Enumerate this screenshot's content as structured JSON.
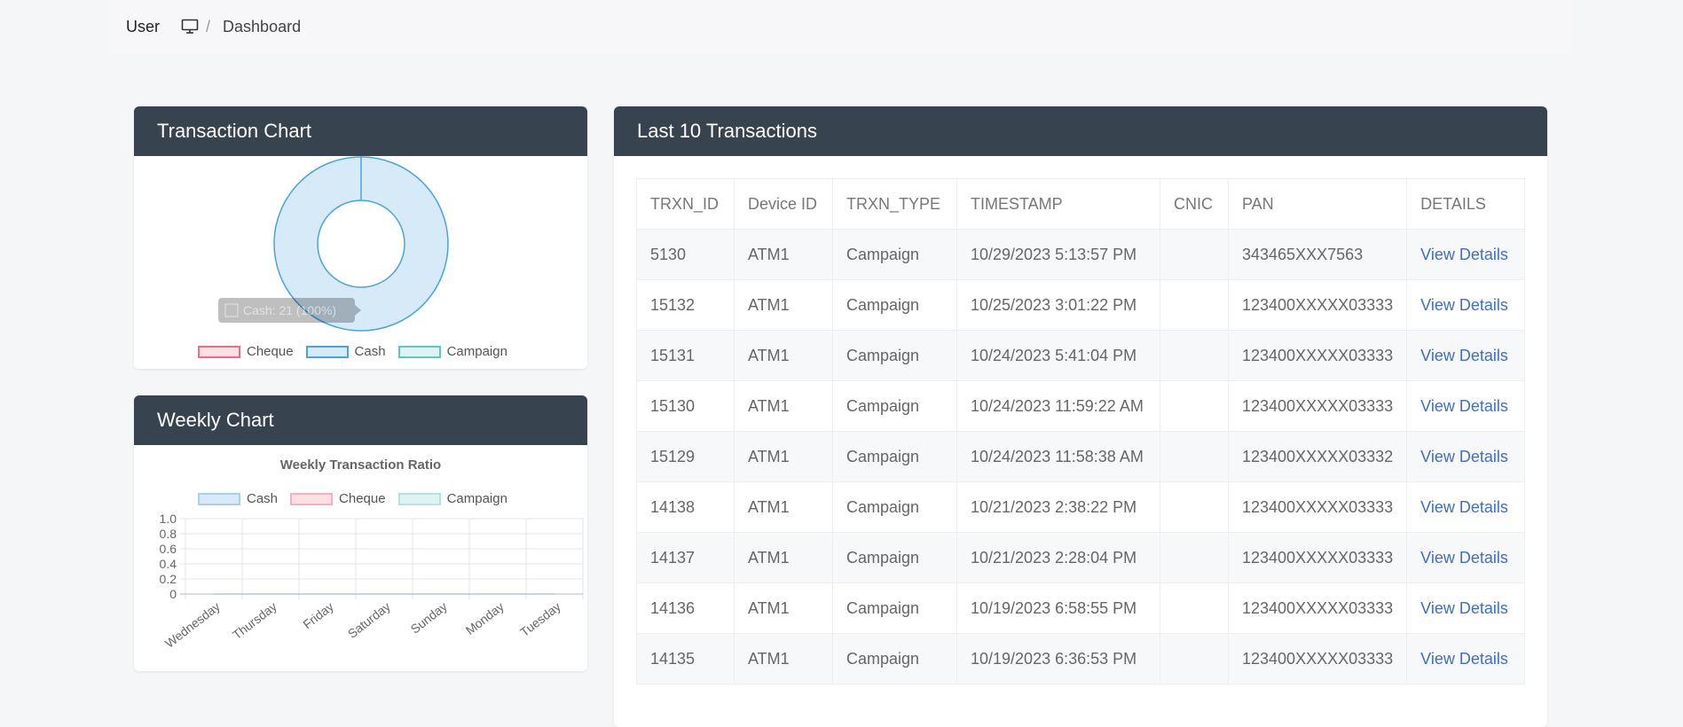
{
  "topbar": {
    "user_label": "User",
    "breadcrumb_icon": "monitor-icon",
    "breadcrumb_separator": "/",
    "breadcrumb_current": "Dashboard"
  },
  "transaction_chart": {
    "title": "Transaction Chart",
    "tooltip": "Cash: 21 (100%)",
    "legend": [
      "Cheque",
      "Cash",
      "Campaign"
    ]
  },
  "weekly_chart": {
    "title": "Weekly Chart"
  },
  "last10": {
    "title": "Last 10 Transactions",
    "columns": [
      "TRXN_ID",
      "Device ID",
      "TRXN_TYPE",
      "TIMESTAMP",
      "CNIC",
      "PAN",
      "DETAILS"
    ],
    "rows": [
      {
        "id": "5130",
        "device": "ATM1",
        "type": "Campaign",
        "ts": "10/29/2023 5:13:57 PM",
        "cnic": "",
        "pan": "343465XXX7563",
        "details": "View Details"
      },
      {
        "id": "15132",
        "device": "ATM1",
        "type": "Campaign",
        "ts": "10/25/2023 3:01:22 PM",
        "cnic": "",
        "pan": "123400XXXXX03333",
        "details": "View Details"
      },
      {
        "id": "15131",
        "device": "ATM1",
        "type": "Campaign",
        "ts": "10/24/2023 5:41:04 PM",
        "cnic": "",
        "pan": "123400XXXXX03333",
        "details": "View Details"
      },
      {
        "id": "15130",
        "device": "ATM1",
        "type": "Campaign",
        "ts": "10/24/2023 11:59:22 AM",
        "cnic": "",
        "pan": "123400XXXXX03333",
        "details": "View Details"
      },
      {
        "id": "15129",
        "device": "ATM1",
        "type": "Campaign",
        "ts": "10/24/2023 11:58:38 AM",
        "cnic": "",
        "pan": "123400XXXXX03332",
        "details": "View Details"
      },
      {
        "id": "14138",
        "device": "ATM1",
        "type": "Campaign",
        "ts": "10/21/2023 2:38:22 PM",
        "cnic": "",
        "pan": "123400XXXXX03333",
        "details": "View Details"
      },
      {
        "id": "14137",
        "device": "ATM1",
        "type": "Campaign",
        "ts": "10/21/2023 2:28:04 PM",
        "cnic": "",
        "pan": "123400XXXXX03333",
        "details": "View Details"
      },
      {
        "id": "14136",
        "device": "ATM1",
        "type": "Campaign",
        "ts": "10/19/2023 6:58:55 PM",
        "cnic": "",
        "pan": "123400XXXXX03333",
        "details": "View Details"
      },
      {
        "id": "14135",
        "device": "ATM1",
        "type": "Campaign",
        "ts": "10/19/2023 6:36:53 PM",
        "cnic": "",
        "pan": "123400XXXXX03333",
        "details": "View Details"
      }
    ]
  },
  "colors": {
    "header_bg": "#37444f",
    "link": "#3f6ec6",
    "cash_fill": "#d6eaf8",
    "cash_border": "#4aa3df",
    "cheque_fill": "#fde0e6",
    "cheque_border": "#f06b86",
    "campaign_fill": "#dff3f2",
    "campaign_border": "#5cc8c0"
  },
  "chart_data": [
    {
      "type": "pie",
      "categories": [
        "Cheque",
        "Cash",
        "Campaign"
      ],
      "values": [
        0,
        21,
        0
      ],
      "legend": "top"
    },
    {
      "type": "line",
      "title": "Weekly Transaction Ratio",
      "categories": [
        "Wednesday",
        "Thursday",
        "Friday",
        "Saturday",
        "Sunday",
        "Monday",
        "Tuesday"
      ],
      "series": [
        {
          "name": "Cash",
          "values": [
            0,
            0,
            0,
            0,
            0,
            0,
            0
          ]
        },
        {
          "name": "Cheque",
          "values": [
            0,
            0,
            0,
            0,
            0,
            0,
            0
          ]
        },
        {
          "name": "Campaign",
          "values": [
            0,
            0,
            0,
            0,
            0,
            0,
            0
          ]
        }
      ],
      "yticks": [
        "1.0",
        "0.8",
        "0.6",
        "0.4",
        "0.2",
        "0"
      ],
      "ylim": [
        0,
        1
      ],
      "grid": true,
      "legend": "top"
    }
  ]
}
